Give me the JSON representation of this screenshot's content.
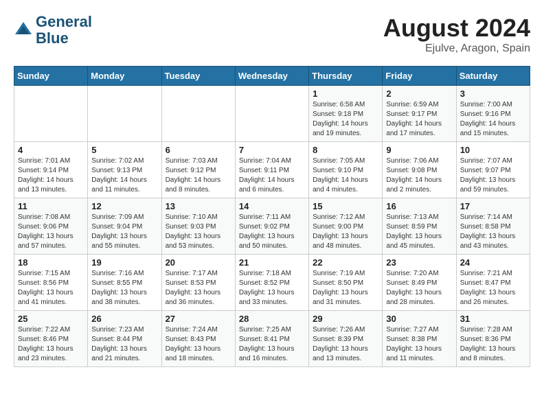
{
  "header": {
    "logo_line1": "General",
    "logo_line2": "Blue",
    "month_year": "August 2024",
    "location": "Ejulve, Aragon, Spain"
  },
  "days_of_week": [
    "Sunday",
    "Monday",
    "Tuesday",
    "Wednesday",
    "Thursday",
    "Friday",
    "Saturday"
  ],
  "weeks": [
    [
      {
        "day": "",
        "info": ""
      },
      {
        "day": "",
        "info": ""
      },
      {
        "day": "",
        "info": ""
      },
      {
        "day": "",
        "info": ""
      },
      {
        "day": "1",
        "info": "Sunrise: 6:58 AM\nSunset: 9:18 PM\nDaylight: 14 hours\nand 19 minutes."
      },
      {
        "day": "2",
        "info": "Sunrise: 6:59 AM\nSunset: 9:17 PM\nDaylight: 14 hours\nand 17 minutes."
      },
      {
        "day": "3",
        "info": "Sunrise: 7:00 AM\nSunset: 9:16 PM\nDaylight: 14 hours\nand 15 minutes."
      }
    ],
    [
      {
        "day": "4",
        "info": "Sunrise: 7:01 AM\nSunset: 9:14 PM\nDaylight: 14 hours\nand 13 minutes."
      },
      {
        "day": "5",
        "info": "Sunrise: 7:02 AM\nSunset: 9:13 PM\nDaylight: 14 hours\nand 11 minutes."
      },
      {
        "day": "6",
        "info": "Sunrise: 7:03 AM\nSunset: 9:12 PM\nDaylight: 14 hours\nand 8 minutes."
      },
      {
        "day": "7",
        "info": "Sunrise: 7:04 AM\nSunset: 9:11 PM\nDaylight: 14 hours\nand 6 minutes."
      },
      {
        "day": "8",
        "info": "Sunrise: 7:05 AM\nSunset: 9:10 PM\nDaylight: 14 hours\nand 4 minutes."
      },
      {
        "day": "9",
        "info": "Sunrise: 7:06 AM\nSunset: 9:08 PM\nDaylight: 14 hours\nand 2 minutes."
      },
      {
        "day": "10",
        "info": "Sunrise: 7:07 AM\nSunset: 9:07 PM\nDaylight: 13 hours\nand 59 minutes."
      }
    ],
    [
      {
        "day": "11",
        "info": "Sunrise: 7:08 AM\nSunset: 9:06 PM\nDaylight: 13 hours\nand 57 minutes."
      },
      {
        "day": "12",
        "info": "Sunrise: 7:09 AM\nSunset: 9:04 PM\nDaylight: 13 hours\nand 55 minutes."
      },
      {
        "day": "13",
        "info": "Sunrise: 7:10 AM\nSunset: 9:03 PM\nDaylight: 13 hours\nand 53 minutes."
      },
      {
        "day": "14",
        "info": "Sunrise: 7:11 AM\nSunset: 9:02 PM\nDaylight: 13 hours\nand 50 minutes."
      },
      {
        "day": "15",
        "info": "Sunrise: 7:12 AM\nSunset: 9:00 PM\nDaylight: 13 hours\nand 48 minutes."
      },
      {
        "day": "16",
        "info": "Sunrise: 7:13 AM\nSunset: 8:59 PM\nDaylight: 13 hours\nand 45 minutes."
      },
      {
        "day": "17",
        "info": "Sunrise: 7:14 AM\nSunset: 8:58 PM\nDaylight: 13 hours\nand 43 minutes."
      }
    ],
    [
      {
        "day": "18",
        "info": "Sunrise: 7:15 AM\nSunset: 8:56 PM\nDaylight: 13 hours\nand 41 minutes."
      },
      {
        "day": "19",
        "info": "Sunrise: 7:16 AM\nSunset: 8:55 PM\nDaylight: 13 hours\nand 38 minutes."
      },
      {
        "day": "20",
        "info": "Sunrise: 7:17 AM\nSunset: 8:53 PM\nDaylight: 13 hours\nand 36 minutes."
      },
      {
        "day": "21",
        "info": "Sunrise: 7:18 AM\nSunset: 8:52 PM\nDaylight: 13 hours\nand 33 minutes."
      },
      {
        "day": "22",
        "info": "Sunrise: 7:19 AM\nSunset: 8:50 PM\nDaylight: 13 hours\nand 31 minutes."
      },
      {
        "day": "23",
        "info": "Sunrise: 7:20 AM\nSunset: 8:49 PM\nDaylight: 13 hours\nand 28 minutes."
      },
      {
        "day": "24",
        "info": "Sunrise: 7:21 AM\nSunset: 8:47 PM\nDaylight: 13 hours\nand 26 minutes."
      }
    ],
    [
      {
        "day": "25",
        "info": "Sunrise: 7:22 AM\nSunset: 8:46 PM\nDaylight: 13 hours\nand 23 minutes."
      },
      {
        "day": "26",
        "info": "Sunrise: 7:23 AM\nSunset: 8:44 PM\nDaylight: 13 hours\nand 21 minutes."
      },
      {
        "day": "27",
        "info": "Sunrise: 7:24 AM\nSunset: 8:43 PM\nDaylight: 13 hours\nand 18 minutes."
      },
      {
        "day": "28",
        "info": "Sunrise: 7:25 AM\nSunset: 8:41 PM\nDaylight: 13 hours\nand 16 minutes."
      },
      {
        "day": "29",
        "info": "Sunrise: 7:26 AM\nSunset: 8:39 PM\nDaylight: 13 hours\nand 13 minutes."
      },
      {
        "day": "30",
        "info": "Sunrise: 7:27 AM\nSunset: 8:38 PM\nDaylight: 13 hours\nand 11 minutes."
      },
      {
        "day": "31",
        "info": "Sunrise: 7:28 AM\nSunset: 8:36 PM\nDaylight: 13 hours\nand 8 minutes."
      }
    ]
  ]
}
